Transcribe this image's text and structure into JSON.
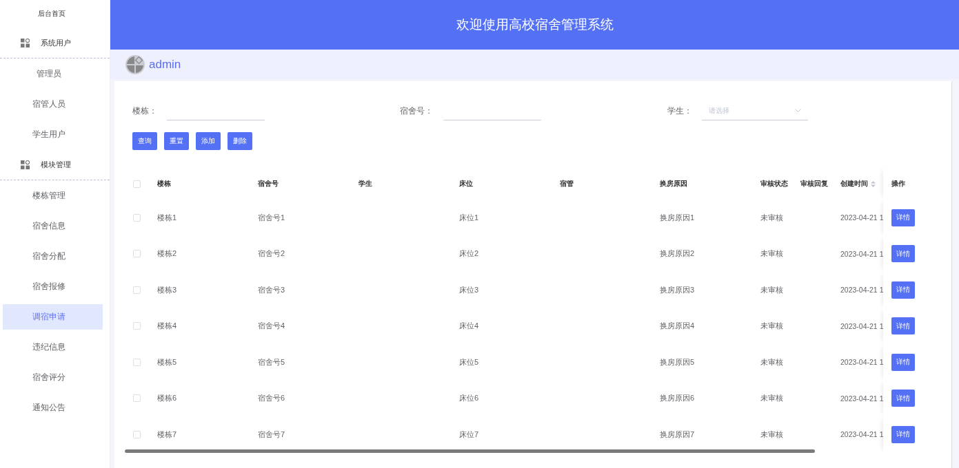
{
  "sidebar": {
    "home": "后台首页",
    "groups": [
      {
        "title": "系统用户",
        "items": [
          {
            "label": "管理员",
            "selected": false
          },
          {
            "label": "宿管人员",
            "selected": false
          },
          {
            "label": "学生用户",
            "selected": false
          }
        ]
      },
      {
        "title": "模块管理",
        "items": [
          {
            "label": "楼栋管理",
            "selected": false
          },
          {
            "label": "宿舍信息",
            "selected": false
          },
          {
            "label": "宿舍分配",
            "selected": false
          },
          {
            "label": "宿舍报修",
            "selected": false
          },
          {
            "label": "调宿申请",
            "selected": true
          },
          {
            "label": "违纪信息",
            "selected": false
          },
          {
            "label": "宿舍评分",
            "selected": false
          },
          {
            "label": "通知公告",
            "selected": false
          }
        ]
      }
    ]
  },
  "header": {
    "title": "欢迎使用高校宿舍管理系统"
  },
  "user": {
    "name": "admin"
  },
  "filters": [
    {
      "kind": "text",
      "label": "楼栋："
    },
    {
      "kind": "text",
      "label": "宿舍号："
    },
    {
      "kind": "select",
      "label": "学生：",
      "placeholder": "请选择"
    }
  ],
  "buttons": [
    "查询",
    "重置",
    "添加",
    "删除"
  ],
  "table": {
    "header_checked": false,
    "columns": [
      {
        "label": "楼栋",
        "sortable": false
      },
      {
        "label": "宿舍号",
        "sortable": false
      },
      {
        "label": "学生",
        "sortable": false
      },
      {
        "label": "床位",
        "sortable": false
      },
      {
        "label": "宿管",
        "sortable": false
      },
      {
        "label": "换房原因",
        "sortable": false
      },
      {
        "label": "审核状态",
        "sortable": false
      },
      {
        "label": "审核回复",
        "sortable": false
      },
      {
        "label": "创建时间",
        "sortable": true
      },
      {
        "label": "操作",
        "sortable": false
      }
    ],
    "rows": [
      {
        "checked": false,
        "building": "楼栋1",
        "room": "宿舍号1",
        "bed": "床位1",
        "reason": "换房原因1",
        "status": "未审核",
        "created": "2023-04-21 1",
        "action": "详情"
      },
      {
        "checked": false,
        "building": "楼栋2",
        "room": "宿舍号2",
        "bed": "床位2",
        "reason": "换房原因2",
        "status": "未审核",
        "created": "2023-04-21 1",
        "action": "详情"
      },
      {
        "checked": false,
        "building": "楼栋3",
        "room": "宿舍号3",
        "bed": "床位3",
        "reason": "换房原因3",
        "status": "未审核",
        "created": "2023-04-21 1",
        "action": "详情"
      },
      {
        "checked": false,
        "building": "楼栋4",
        "room": "宿舍号4",
        "bed": "床位4",
        "reason": "换房原因4",
        "status": "未审核",
        "created": "2023-04-21 1",
        "action": "详情"
      },
      {
        "checked": false,
        "building": "楼栋5",
        "room": "宿舍号5",
        "bed": "床位5",
        "reason": "换房原因5",
        "status": "未审核",
        "created": "2023-04-21 1",
        "action": "详情"
      },
      {
        "checked": false,
        "building": "楼栋6",
        "room": "宿舍号6",
        "bed": "床位6",
        "reason": "换房原因6",
        "status": "未审核",
        "created": "2023-04-21 1",
        "action": "详情"
      },
      {
        "checked": false,
        "building": "楼栋7",
        "room": "宿舍号7",
        "bed": "床位7",
        "reason": "换房原因7",
        "status": "未审核",
        "created": "2023-04-21 1",
        "action": "详情"
      }
    ]
  }
}
